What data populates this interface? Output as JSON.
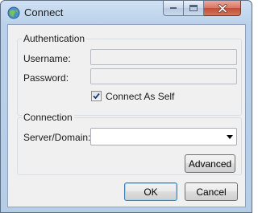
{
  "window": {
    "title": "Connect",
    "icon": "globe-icon"
  },
  "authentication": {
    "group_label": "Authentication",
    "username_label": "Username:",
    "username_value": "",
    "password_label": "Password:",
    "password_value": "",
    "connect_as_self_label": "Connect As Self",
    "connect_as_self_checked": true
  },
  "connection": {
    "group_label": "Connection",
    "server_label": "Server/Domain:",
    "server_value": "",
    "advanced_label": "Advanced"
  },
  "footer": {
    "ok_label": "OK",
    "cancel_label": "Cancel"
  },
  "colors": {
    "frame": "#b9d1ea",
    "close_button": "#c44c34",
    "default_button_border": "#3c7fb1"
  }
}
